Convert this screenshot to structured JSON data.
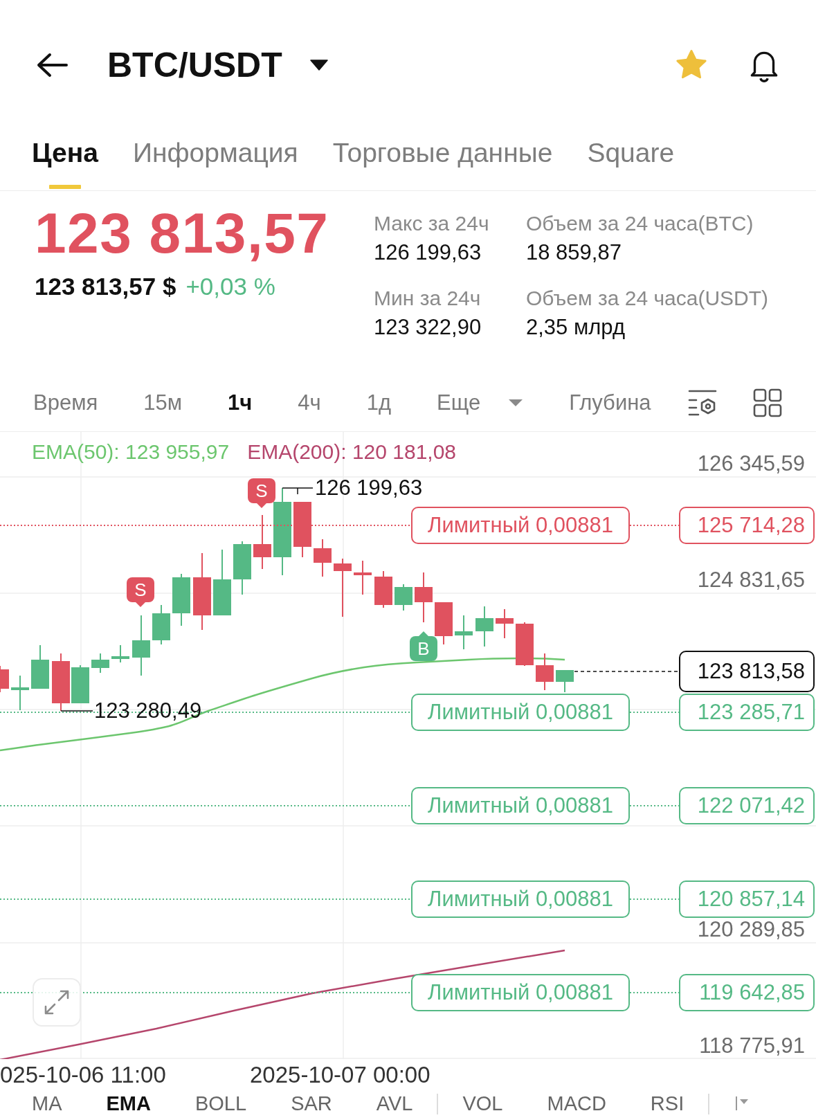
{
  "header": {
    "title": "BTC/USDT",
    "favorite": true
  },
  "tabs": [
    {
      "label": "Цена",
      "selected": true
    },
    {
      "label": "Информация",
      "selected": false
    },
    {
      "label": "Торговые данные",
      "selected": false
    },
    {
      "label": "Square",
      "selected": false
    }
  ],
  "price": {
    "last": "123 813,57",
    "fiat": "123 813,57 $",
    "change": "+0,03 %"
  },
  "stats": [
    {
      "label": "Макс за 24ч",
      "value": "126 199,63"
    },
    {
      "label": "Объем за 24 часа(BTC)",
      "value": "18 859,87"
    },
    {
      "label": "Мин за 24ч",
      "value": "123 322,90"
    },
    {
      "label": "Объем за 24 часа(USDT)",
      "value": "2,35 млрд"
    }
  ],
  "intervals": [
    {
      "label": "Время",
      "kind": "option",
      "selected": false
    },
    {
      "label": "15м",
      "kind": "option",
      "selected": false
    },
    {
      "label": "1ч",
      "kind": "option",
      "selected": true
    },
    {
      "label": "4ч",
      "kind": "option",
      "selected": false
    },
    {
      "label": "1д",
      "kind": "option",
      "selected": false
    },
    {
      "label": "Еще",
      "kind": "dropdown",
      "selected": false
    },
    {
      "label": "Глубина",
      "kind": "option",
      "selected": false
    }
  ],
  "chart": {
    "indicators": [
      {
        "label": "EMA(50): 123 955,97",
        "color": "#6cc66e"
      },
      {
        "label": "EMA(200): 120 181,08",
        "color": "#b5466c"
      }
    ],
    "price_axis": [
      "126 345,59",
      "124 831,65",
      "120 289,85",
      "118 775,91"
    ],
    "high_label": "126 199,63",
    "low_label": "123 280,49",
    "markers": [
      {
        "label": "S",
        "kind": "sell"
      },
      {
        "label": "S",
        "kind": "sell"
      },
      {
        "label": "B",
        "kind": "buy"
      }
    ],
    "orders": [
      {
        "label": "Лимитный 0,00881",
        "price": "125 714,28",
        "color": "#e0525f"
      },
      {
        "label": "Лимитный 0,00881",
        "price": "123 285,71",
        "color": "#55b985"
      },
      {
        "label": "Лимитный 0,00881",
        "price": "122 071,42",
        "color": "#55b985"
      },
      {
        "label": "Лимитный 0,00881",
        "price": "120 857,14",
        "color": "#55b985"
      },
      {
        "label": "Лимитный 0,00881",
        "price": "119 642,85",
        "color": "#55b985"
      }
    ],
    "current_price": "123 813,58",
    "time_axis": [
      "025-10-06 11:00",
      "2025-10-07 00:00"
    ]
  },
  "indicator_groups": [
    {
      "items": [
        {
          "label": "MA",
          "selected": false
        },
        {
          "label": "EMA",
          "selected": true
        },
        {
          "label": "BOLL",
          "selected": false
        },
        {
          "label": "SAR",
          "selected": false
        },
        {
          "label": "AVL",
          "selected": false
        }
      ]
    },
    {
      "items": [
        {
          "label": "VOL",
          "selected": false
        },
        {
          "label": "MACD",
          "selected": false
        },
        {
          "label": "RSI",
          "selected": false
        }
      ]
    }
  ]
}
